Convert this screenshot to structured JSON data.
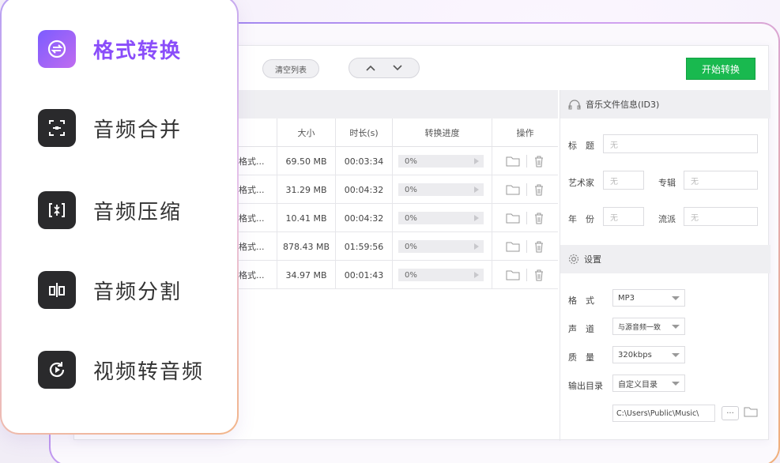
{
  "toolbar": {
    "clear_label": "清空列表",
    "up_glyph": "∧",
    "down_glyph": "∨",
    "start_label": "开始转换"
  },
  "table": {
    "headers": [
      "大小",
      "时长(s)",
      "转换进度",
      "操作"
    ],
    "rows": [
      {
        "name": "格式...",
        "size": "69.50 MB",
        "duration": "00:03:34",
        "progress": "0%"
      },
      {
        "name": "格式...",
        "size": "31.29 MB",
        "duration": "00:04:32",
        "progress": "0%"
      },
      {
        "name": "格式...",
        "size": "10.41 MB",
        "duration": "00:04:32",
        "progress": "0%"
      },
      {
        "name": "格式...",
        "size": "878.43 MB",
        "duration": "01:59:56",
        "progress": "0%"
      },
      {
        "name": "格式...",
        "size": "34.97 MB",
        "duration": "00:01:43",
        "progress": "0%"
      }
    ]
  },
  "id3": {
    "section_title": "音乐文件信息(ID3)",
    "title_label": "标　题",
    "artist_label": "艺术家",
    "album_label": "专辑",
    "year_label": "年　份",
    "genre_label": "流派",
    "empty_value": "无"
  },
  "settings": {
    "section_title": "设置",
    "format_label": "格　式",
    "format_value": "MP3",
    "channel_label": "声　道",
    "channel_value": "与源音频一致",
    "quality_label": "质　量",
    "quality_value": "320kbps",
    "output_label": "输出目录",
    "output_value": "自定义目录",
    "path_value": "C:\\Users\\Public\\Music\\",
    "dots": "···"
  },
  "menu": {
    "items": [
      {
        "label": "格式转换",
        "icon": "format-convert-icon",
        "active": true
      },
      {
        "label": "音频合并",
        "icon": "audio-merge-icon",
        "active": false
      },
      {
        "label": "音频压缩",
        "icon": "audio-compress-icon",
        "active": false
      },
      {
        "label": "音频分割",
        "icon": "audio-split-icon",
        "active": false
      },
      {
        "label": "视频转音频",
        "icon": "video-to-audio-icon",
        "active": false
      }
    ]
  },
  "colors": {
    "accent": "#8a4dfa",
    "start_button": "#19b94f",
    "menu_icon_bg": "#2a2a2c"
  }
}
